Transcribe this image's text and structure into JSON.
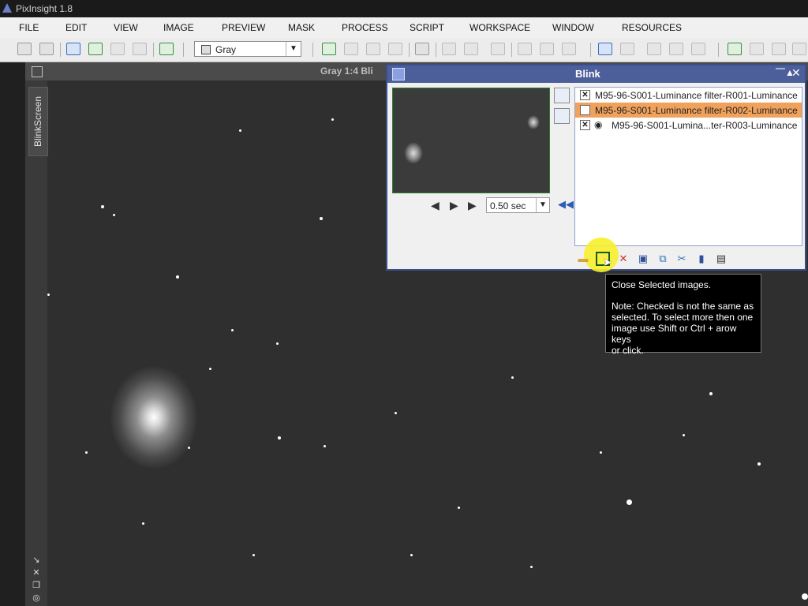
{
  "app": {
    "title": "PixInsight 1.8"
  },
  "menu": [
    "FILE",
    "EDIT",
    "VIEW",
    "IMAGE",
    "PREVIEW",
    "MASK",
    "PROCESS",
    "SCRIPT",
    "WORKSPACE",
    "WINDOW",
    "RESOURCES"
  ],
  "toolbar": {
    "colorspace": "Gray"
  },
  "sidebar": {
    "tab": "BlinkScreen"
  },
  "image_window": {
    "title": "Gray 1:4 Bli"
  },
  "blink": {
    "title": "Blink",
    "speed": "0.50 sec",
    "files": [
      {
        "name": "M95-96-S001-Luminance filter-R001-Luminance",
        "checked": true,
        "selected": false
      },
      {
        "name": "M95-96-S001-Luminance filter-R002-Luminance",
        "checked": false,
        "selected": true
      },
      {
        "name": "M95-96-S001-Lumina...ter-R003-Luminance",
        "checked": true,
        "selected": false
      }
    ]
  },
  "tooltip": {
    "title": "Close Selected images.",
    "line1": "Note: Checked is not the same as",
    "line2": "selected. To select more then one",
    "line3": "image use Shift or Ctrl + arow keys",
    "line4": "or click."
  },
  "colors": {
    "blink_header": "#4d5f9a",
    "selected_row": "#f0a15b",
    "highlight": "#f7ef2d"
  }
}
